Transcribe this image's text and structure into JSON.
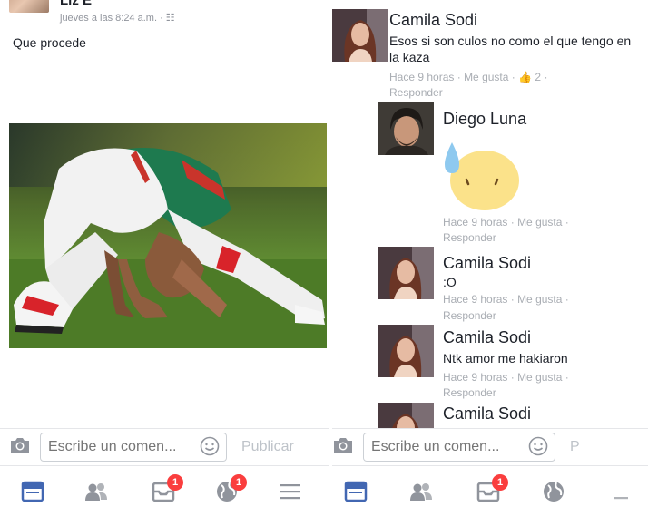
{
  "left": {
    "post": {
      "author": "Liz E",
      "meta": "jueves a las 8:24 a.m. · ☷",
      "text": "Que procede"
    },
    "comment_bar": {
      "placeholder": "Escribe un comen...",
      "publish_label": "Publicar"
    },
    "nav": {
      "notifications_badge": "1",
      "globe_badge": "1"
    }
  },
  "right": {
    "comments": [
      {
        "name": "Camila Sodi",
        "text": "Esos si son culos no como el que tengo en la kaza",
        "time": "Hace 9 horas",
        "like": "Me gusta",
        "likes": "2",
        "reply": "Responder"
      },
      {
        "name": "Diego Luna",
        "time": "Hace 9 horas",
        "like": "Me gusta",
        "reply": "Responder"
      },
      {
        "name": "Camila Sodi",
        "text": ":O",
        "time": "Hace 9 horas",
        "like": "Me gusta",
        "reply": "Responder"
      },
      {
        "name": "Camila Sodi",
        "text": "Ntk amor me hakiaron",
        "time": "Hace 9 horas",
        "like": "Me gusta",
        "reply": "Responder"
      },
      {
        "name": "Camila Sodi"
      }
    ],
    "comment_bar": {
      "placeholder": "Escribe un comen...",
      "publish_label": "P"
    },
    "nav": {
      "notifications_badge": "1"
    }
  },
  "colors": {
    "accent": "#4267b2",
    "badge": "#fa3e3e",
    "meta_text": "#a9adb3",
    "icon_grey": "#90949c"
  }
}
